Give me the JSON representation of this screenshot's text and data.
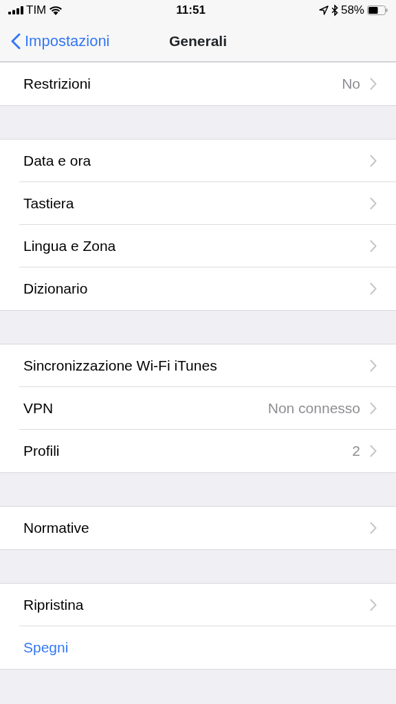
{
  "status_bar": {
    "carrier": "TIM",
    "time": "11:51",
    "battery": "58%"
  },
  "nav": {
    "back": "Impostazioni",
    "title": "Generali"
  },
  "groups": [
    {
      "rows": [
        {
          "kind": "nav",
          "label": "Restrizioni",
          "value": "No"
        }
      ]
    },
    {
      "rows": [
        {
          "kind": "nav",
          "label": "Data e ora"
        },
        {
          "kind": "nav",
          "label": "Tastiera"
        },
        {
          "kind": "nav",
          "label": "Lingua e Zona"
        },
        {
          "kind": "nav",
          "label": "Dizionario"
        }
      ]
    },
    {
      "rows": [
        {
          "kind": "nav",
          "label": "Sincronizzazione Wi-Fi iTunes"
        },
        {
          "kind": "nav",
          "label": "VPN",
          "value": "Non connesso"
        },
        {
          "kind": "nav",
          "label": "Profili",
          "value": "2"
        }
      ]
    },
    {
      "rows": [
        {
          "kind": "nav",
          "label": "Normative"
        }
      ]
    },
    {
      "rows": [
        {
          "kind": "nav",
          "label": "Ripristina"
        },
        {
          "kind": "action",
          "label": "Spegni"
        }
      ]
    }
  ]
}
